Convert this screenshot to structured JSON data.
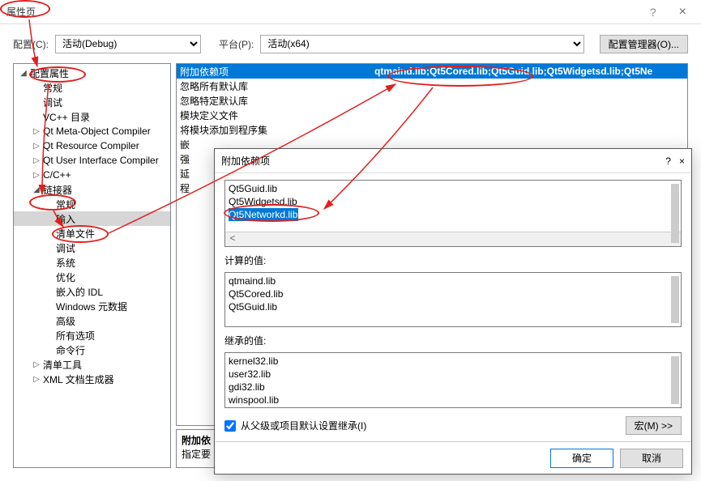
{
  "window": {
    "title": "属性页",
    "help_icon": "?",
    "close_icon": "×"
  },
  "toprow": {
    "config_label": "配置(C):",
    "config_value": "活动(Debug)",
    "platform_label": "平台(P):",
    "platform_value": "活动(x64)",
    "config_mgr_label": "配置管理器(O)..."
  },
  "tree": {
    "items": [
      {
        "depth": 0,
        "exp": "◢",
        "label": "配置属性"
      },
      {
        "depth": 1,
        "exp": "",
        "label": "常规"
      },
      {
        "depth": 1,
        "exp": "",
        "label": "调试"
      },
      {
        "depth": 1,
        "exp": "",
        "label": "VC++ 目录"
      },
      {
        "depth": 1,
        "exp": "▷",
        "label": "Qt Meta-Object Compiler"
      },
      {
        "depth": 1,
        "exp": "▷",
        "label": "Qt Resource Compiler"
      },
      {
        "depth": 1,
        "exp": "▷",
        "label": "Qt User Interface Compiler"
      },
      {
        "depth": 1,
        "exp": "▷",
        "label": "C/C++"
      },
      {
        "depth": 1,
        "exp": "◢",
        "label": "链接器"
      },
      {
        "depth": 2,
        "exp": "",
        "label": "常规"
      },
      {
        "depth": 2,
        "exp": "",
        "label": "输入",
        "selected": true
      },
      {
        "depth": 2,
        "exp": "",
        "label": "清单文件"
      },
      {
        "depth": 2,
        "exp": "",
        "label": "调试"
      },
      {
        "depth": 2,
        "exp": "",
        "label": "系统"
      },
      {
        "depth": 2,
        "exp": "",
        "label": "优化"
      },
      {
        "depth": 2,
        "exp": "",
        "label": "嵌入的 IDL"
      },
      {
        "depth": 2,
        "exp": "",
        "label": "Windows 元数据"
      },
      {
        "depth": 2,
        "exp": "",
        "label": "高级"
      },
      {
        "depth": 2,
        "exp": "",
        "label": "所有选项"
      },
      {
        "depth": 2,
        "exp": "",
        "label": "命令行"
      },
      {
        "depth": 1,
        "exp": "▷",
        "label": "清单工具"
      },
      {
        "depth": 1,
        "exp": "▷",
        "label": "XML 文档生成器"
      }
    ]
  },
  "grid": {
    "rows": [
      {
        "k": "附加依赖项",
        "v": "qtmaind.lib;Qt5Cored.lib;Qt5Guid.lib;Qt5Widgetsd.lib;Qt5Ne",
        "sel": true
      },
      {
        "k": "忽略所有默认库",
        "v": ""
      },
      {
        "k": "忽略特定默认库",
        "v": ""
      },
      {
        "k": "模块定义文件",
        "v": ""
      },
      {
        "k": "将模块添加到程序集",
        "v": ""
      },
      {
        "k": "嵌",
        "v": ""
      },
      {
        "k": "强",
        "v": ""
      },
      {
        "k": "延",
        "v": ""
      },
      {
        "k": "程",
        "v": ""
      }
    ],
    "desc_title": "附加依",
    "desc_body": "指定要"
  },
  "modal": {
    "title": "附加依赖项",
    "help_icon": "?",
    "close_icon": "×",
    "edit_lines": [
      "Qt5Guid.lib",
      "Qt5Widgetsd.lib",
      {
        "text": "Qt5Networkd.lib",
        "sel": true
      }
    ],
    "scroll_left": "<",
    "scroll_right": ">",
    "computed_label": "计算的值:",
    "computed": [
      "qtmaind.lib",
      "Qt5Cored.lib",
      "Qt5Guid.lib"
    ],
    "inherited_label": "继承的值:",
    "inherited": [
      "kernel32.lib",
      "user32.lib",
      "gdi32.lib",
      "winspool.lib"
    ],
    "inherit_checkbox_label": "从父级或项目默认设置继承(I)",
    "inherit_checked": true,
    "macro_button": "宏(M) >>",
    "ok": "确定",
    "cancel": "取消"
  }
}
